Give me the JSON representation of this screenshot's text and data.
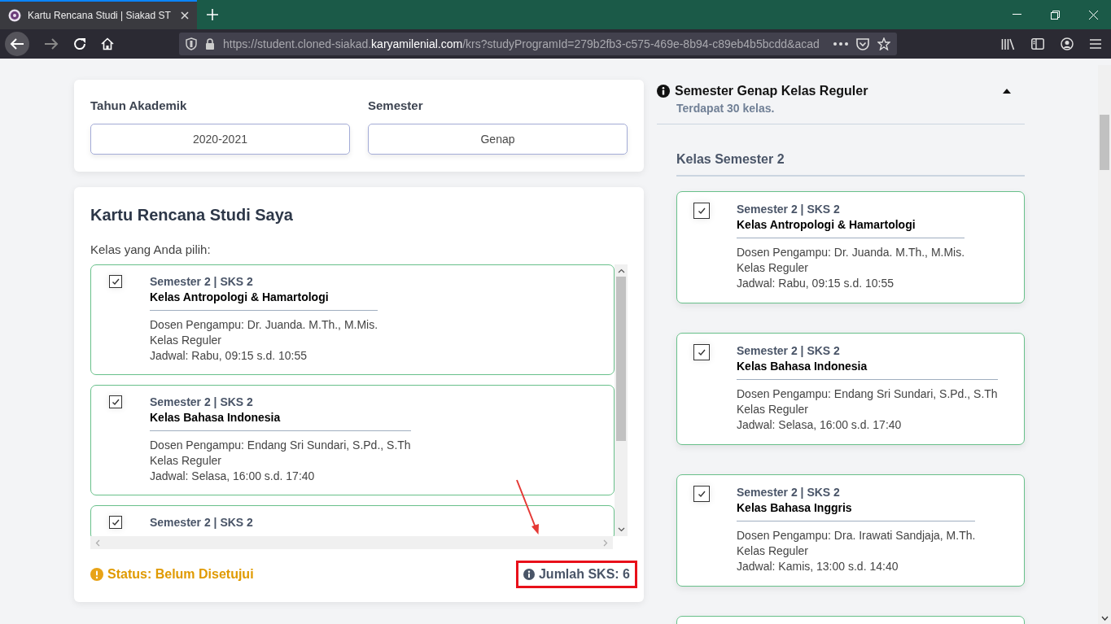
{
  "browser": {
    "tab_title": "Kartu Rencana Studi | Siakad ST",
    "url_prefix": "https://student.cloned-siakad.",
    "url_domain": "karyamilenial.com",
    "url_path": "/krs?studyProgramId=279b2fb3-c575-469e-8b94-c89eb4b5bcdd&acad"
  },
  "filters": [
    {
      "label": "Tahun Akademik",
      "value": "2020-2021"
    },
    {
      "label": "Semester",
      "value": "Genap"
    }
  ],
  "krs": {
    "title": "Kartu Rencana Studi Saya",
    "subtitle": "Kelas yang Anda pilih:",
    "classes": [
      {
        "checked": true,
        "meta": "Semester 2 | SKS 2",
        "name": "Kelas Antropologi & Hamartologi",
        "lecturer": "Dosen Pengampu: Dr. Juanda. M.Th., M.Mis.",
        "type": "Kelas Reguler",
        "schedule": "Jadwal: Rabu, 09:15 s.d. 10:55"
      },
      {
        "checked": true,
        "meta": "Semester 2 | SKS 2",
        "name": "Kelas Bahasa Indonesia",
        "lecturer": "Dosen Pengampu: Endang Sri Sundari, S.Pd., S.Th",
        "type": "Kelas Reguler",
        "schedule": "Jadwal: Selasa, 16:00 s.d. 17:40"
      },
      {
        "checked": true,
        "meta": "Semester 2 | SKS 2"
      }
    ],
    "status": "Status: Belum Disetujui",
    "total_sks": "Jumlah SKS: 6"
  },
  "offer": {
    "title": "Semester Genap Kelas Reguler",
    "count": "Terdapat 30 kelas.",
    "expanded": true,
    "group_title": "Kelas Semester 2",
    "classes": [
      {
        "checked": true,
        "meta": "Semester 2 | SKS 2",
        "name": "Kelas Antropologi & Hamartologi",
        "lecturer": "Dosen Pengampu: Dr. Juanda. M.Th., M.Mis.",
        "type": "Kelas Reguler",
        "schedule": "Jadwal: Rabu, 09:15 s.d. 10:55"
      },
      {
        "checked": true,
        "meta": "Semester 2 | SKS 2",
        "name": "Kelas Bahasa Indonesia",
        "lecturer": "Dosen Pengampu: Endang Sri Sundari, S.Pd., S.Th",
        "type": "Kelas Reguler",
        "schedule": "Jadwal: Selasa, 16:00 s.d. 17:40"
      },
      {
        "checked": true,
        "meta": "Semester 2 | SKS 2",
        "name": "Kelas Bahasa Inggris",
        "lecturer": "Dosen Pengampu: Dra. Irawati Sandjaja, M.Th.",
        "type": "Kelas Reguler",
        "schedule": "Jadwal: Kamis, 13:00 s.d. 14:40"
      }
    ]
  }
}
